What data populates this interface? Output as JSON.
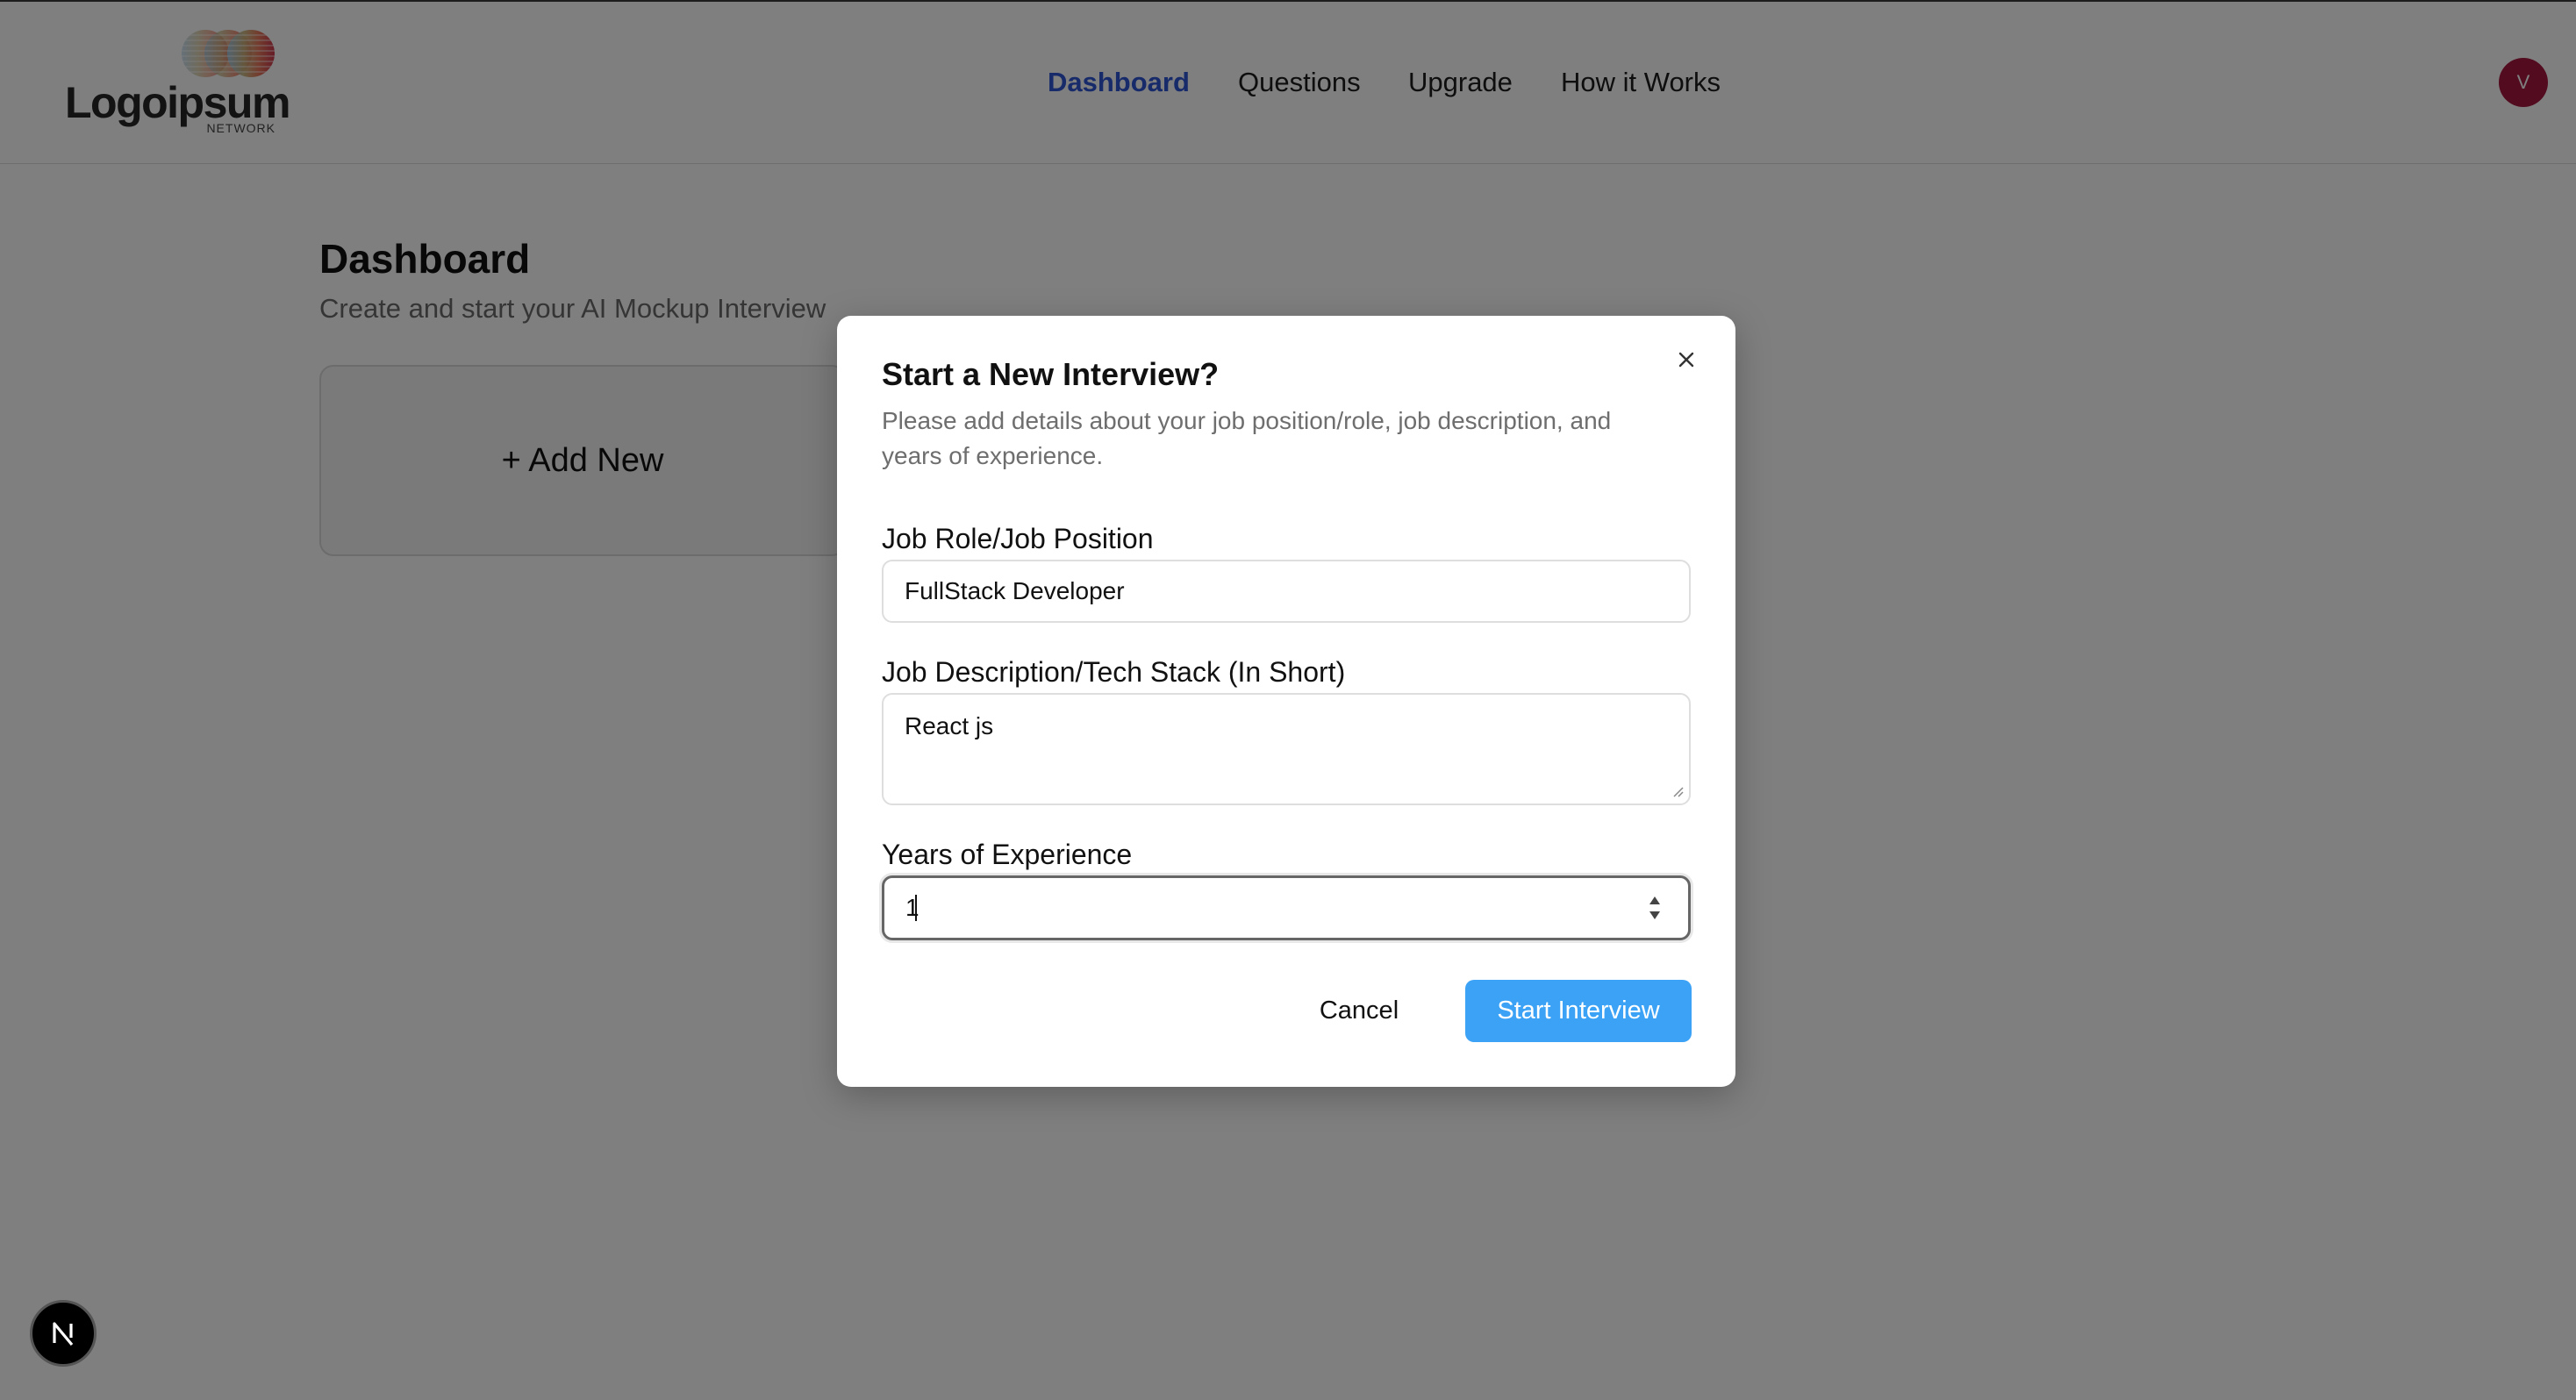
{
  "header": {
    "logo_text": "Logoipsum",
    "logo_subtext": "NETWORK",
    "nav": [
      "Dashboard",
      "Questions",
      "Upgrade",
      "How it Works"
    ],
    "active_nav": "Dashboard",
    "avatar_initial": "V"
  },
  "main": {
    "title": "Dashboard",
    "subtitle": "Create and start your AI Mockup Interview",
    "add_new_label": "+ Add New"
  },
  "dialog": {
    "title": "Start a New Interview?",
    "description": "Please add details about your job position/role, job description, and years of experience.",
    "fields": {
      "job_role": {
        "label": "Job Role/Job Position",
        "value": "FullStack Developer"
      },
      "job_description": {
        "label": "Job Description/Tech Stack (In Short)",
        "value": "React js"
      },
      "years": {
        "label": "Years of Experience",
        "value": "1"
      }
    },
    "cancel_label": "Cancel",
    "start_label": "Start Interview"
  },
  "colors": {
    "accent": "#2f55d4",
    "primary_button": "#3ba2f6",
    "avatar": "#a5173f",
    "overlay": "rgba(0,0,0,0.5)"
  },
  "icons": {
    "close": "close-icon",
    "stepper": "stepper-arrows-icon",
    "framework_badge": "next-n-icon"
  },
  "framework_badge_letter": "N"
}
